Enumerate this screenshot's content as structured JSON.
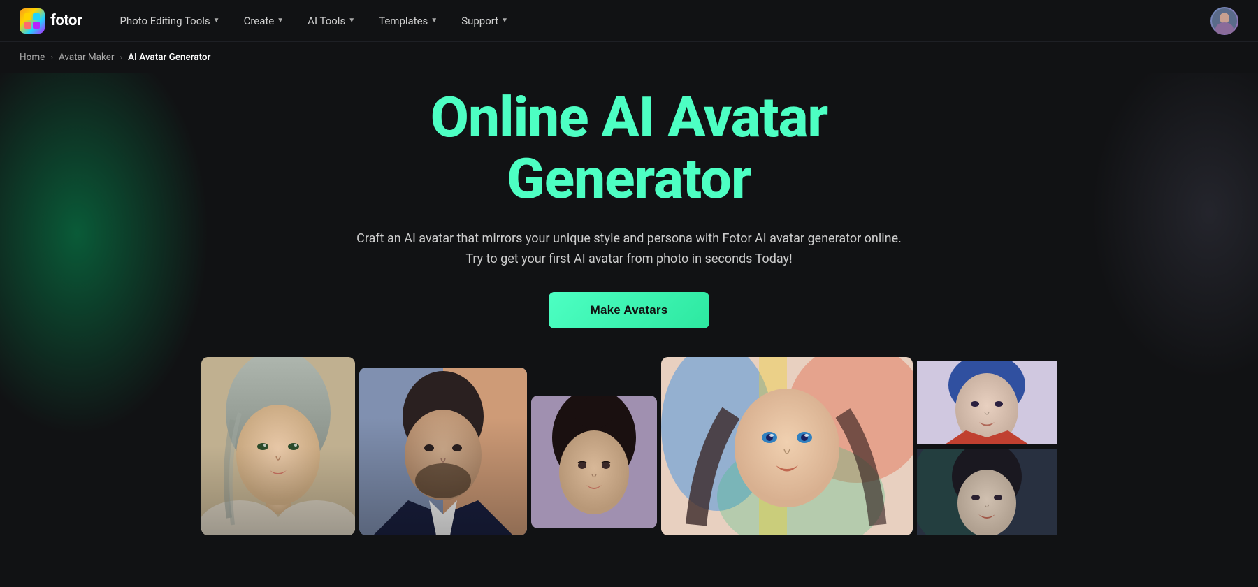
{
  "brand": {
    "name": "fotor",
    "logo_emoji": "🎨"
  },
  "nav": {
    "items": [
      {
        "label": "Photo Editing Tools",
        "has_dropdown": true
      },
      {
        "label": "Create",
        "has_dropdown": true
      },
      {
        "label": "AI Tools",
        "has_dropdown": true
      },
      {
        "label": "Templates",
        "has_dropdown": true
      },
      {
        "label": "Support",
        "has_dropdown": true
      }
    ]
  },
  "breadcrumb": {
    "home": "Home",
    "parent": "Avatar Maker",
    "current": "AI Avatar Generator"
  },
  "hero": {
    "title_line1": "Online AI Avatar",
    "title_line2": "Generator",
    "description": "Craft an AI avatar that mirrors your unique style and persona with Fotor AI avatar generator online. Try to get your first AI avatar from photo in seconds Today!",
    "cta_label": "Make Avatars"
  },
  "gallery": {
    "images": [
      {
        "alt": "AI portrait woman with gray hair"
      },
      {
        "alt": "AI portrait man in suit"
      },
      {
        "alt": "AI portrait woman dark hair"
      },
      {
        "alt": "AI portrait woman colorful art style"
      },
      {
        "alt": "AI portrait woman blue hair"
      }
    ]
  },
  "colors": {
    "accent": "#4dffc3",
    "bg": "#111214",
    "nav_bg": "#111214"
  }
}
